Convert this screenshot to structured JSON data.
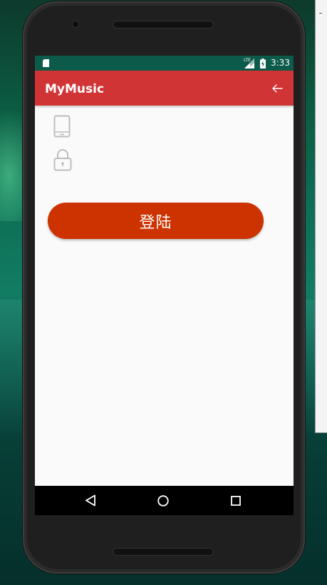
{
  "status_bar": {
    "time": "3:33",
    "network": "LTE",
    "icons": [
      "sd-card-icon",
      "signal-icon",
      "battery-charging-icon"
    ]
  },
  "app_bar": {
    "title": "MyMusic",
    "back_icon": "arrow-left-icon"
  },
  "form": {
    "phone_icon": "smartphone-icon",
    "phone_value": "",
    "lock_icon": "lock-icon",
    "password_value": "",
    "login_label": "登陆"
  },
  "nav_bar": {
    "icons": [
      "nav-back-icon",
      "nav-home-icon",
      "nav-recents-icon"
    ]
  },
  "colors": {
    "status_bar": "#0c5a4a",
    "app_bar": "#d03434",
    "login_button": "#cc3300",
    "background": "#fafafa",
    "icon_gray": "#bdbdbd"
  }
}
